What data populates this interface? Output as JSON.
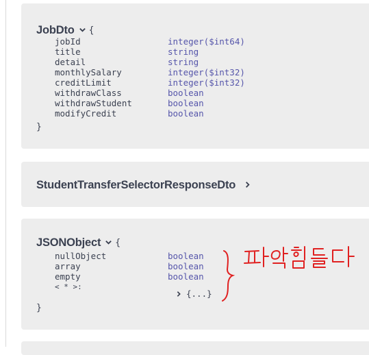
{
  "job_dto": {
    "title": "JobDto",
    "open_brace": "{",
    "close_brace": "}",
    "properties": [
      {
        "name": "jobId",
        "type": "integer($int64)"
      },
      {
        "name": "title",
        "type": "string"
      },
      {
        "name": "detail",
        "type": "string"
      },
      {
        "name": "monthlySalary",
        "type": "integer($int32)"
      },
      {
        "name": "creditLimit",
        "type": "integer($int32)"
      },
      {
        "name": "withdrawClass",
        "type": "boolean"
      },
      {
        "name": "withdrawStudent",
        "type": "boolean"
      },
      {
        "name": "modifyCredit",
        "type": "boolean"
      }
    ]
  },
  "student_transfer": {
    "title": "StudentTransferSelectorResponseDto"
  },
  "json_object": {
    "title": "JSONObject",
    "open_brace": "{",
    "close_brace": "}",
    "properties": [
      {
        "name": "nullObject",
        "type": "boolean"
      },
      {
        "name": "array",
        "type": "boolean"
      },
      {
        "name": "empty",
        "type": "boolean"
      }
    ],
    "additional_label": "< * >:",
    "collapsed_label": "{...}",
    "annotation": "파악힘들다"
  },
  "colors": {
    "card_bg": "#ededed",
    "text": "#3b4151",
    "type": "#55a",
    "annotation": "#e02020"
  }
}
